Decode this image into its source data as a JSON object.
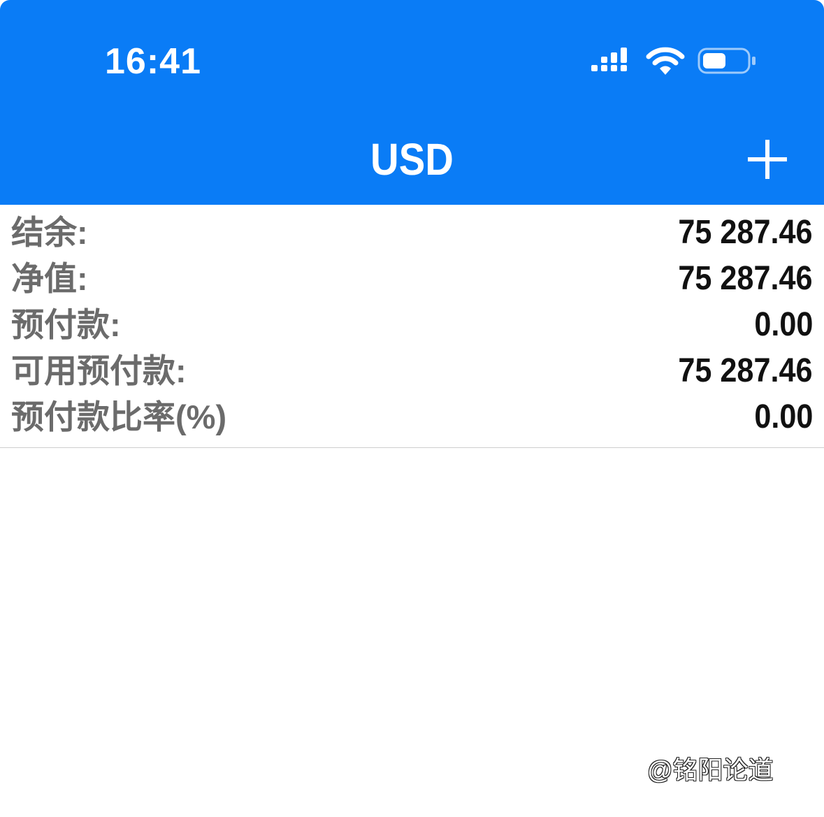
{
  "status_bar": {
    "time": "16:41",
    "icons": [
      "cellular-signal-icon",
      "wifi-icon",
      "battery-icon"
    ]
  },
  "header": {
    "title": "USD",
    "add_icon": "plus-icon",
    "background_color": "#0a7cf6"
  },
  "account": {
    "rows": [
      {
        "label": "结余:",
        "value": "75 287.46"
      },
      {
        "label": "净值:",
        "value": "75 287.46"
      },
      {
        "label": "预付款:",
        "value": "0.00"
      },
      {
        "label": "可用预付款:",
        "value": "75 287.46"
      },
      {
        "label": "预付款比率(%)",
        "value": "0.00"
      }
    ]
  },
  "watermark": {
    "text": "@铭阳论道"
  }
}
